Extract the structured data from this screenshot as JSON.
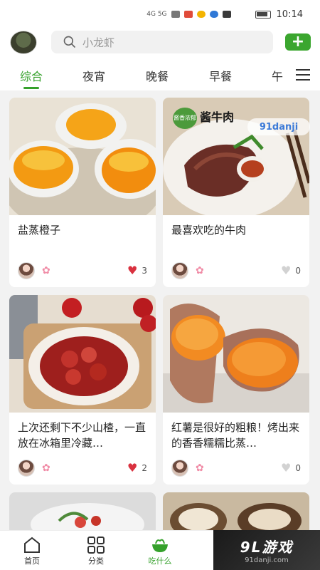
{
  "status_bar": {
    "time": "10:14",
    "network": "4G 5G"
  },
  "search": {
    "placeholder": "小龙虾"
  },
  "header": {
    "add_label": "+"
  },
  "tabs": [
    "综合",
    "夜宵",
    "晚餐",
    "早餐",
    "午"
  ],
  "cards": [
    {
      "title": "盐蒸橙子",
      "likes": "3",
      "liked": true
    },
    {
      "title": "最喜欢吃的牛肉",
      "likes": "0",
      "liked": false,
      "badge": "酱牛肉",
      "badge_small": "酱香浓郁"
    },
    {
      "title": "上次还剩下不少山楂，一直放在冰箱里冷藏…",
      "likes": "2",
      "liked": true
    },
    {
      "title": "红薯是很好的粗粮！烤出来的香香糯糯比蒸…",
      "likes": "0",
      "liked": false
    }
  ],
  "bottom_nav": [
    {
      "label": "首页",
      "icon": "home-icon"
    },
    {
      "label": "分类",
      "icon": "grid-icon"
    },
    {
      "label": "吃什么",
      "icon": "bowl-icon"
    }
  ],
  "watermark": {
    "title": "9L游戏",
    "site": "91danji.com",
    "small": "91danji"
  },
  "colors": {
    "accent": "#35a12b",
    "like": "#d9313f"
  }
}
